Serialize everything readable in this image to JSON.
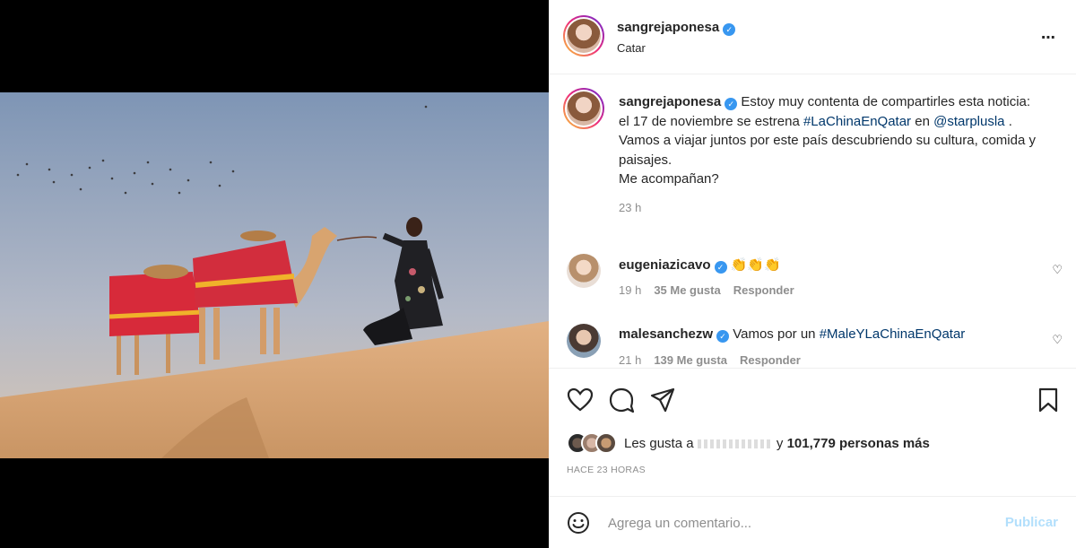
{
  "post": {
    "author": "sangrejaponesa",
    "location": "Catar",
    "more_icon": "⋯"
  },
  "caption": {
    "author": "sangrejaponesa",
    "text_1": "Estoy muy contenta de compartirles esta noticia: el 17 de noviembre se estrena",
    "hashtag": "#LaChinaEnQatar",
    "text_2": "en",
    "mention": "@starplusla",
    "text_3": ".",
    "line_2": "Vamos a viajar juntos por este país descubriendo su cultura, comida y paisajes.",
    "line_3": "Me acompañan?",
    "time": "23 h"
  },
  "comments": [
    {
      "author": "eugeniazicavo",
      "text": "👏👏👏",
      "time": "19 h",
      "likes": "35 Me gusta",
      "reply": "Responder"
    },
    {
      "author": "malesanchezw",
      "text_prefix": "Vamos por un",
      "hashtag": "#MaleYLaChinaEnQatar",
      "time": "21 h",
      "likes": "139 Me gusta",
      "reply": "Responder"
    }
  ],
  "likes": {
    "prefix": "Les gusta a",
    "connector": "y",
    "count_text": "101,779 personas más"
  },
  "timestamp": "HACE 23 HORAS",
  "add_comment": {
    "placeholder": "Agrega un comentario...",
    "publish_label": "Publicar"
  },
  "colors": {
    "link": "#00376b",
    "verified": "#3897f0",
    "muted": "#8e8e8e",
    "publish_disabled": "#b2dffc"
  },
  "icons": [
    "user-tag-icon",
    "more-options-icon",
    "verified-icon",
    "heart-icon",
    "comment-icon",
    "share-icon",
    "bookmark-icon",
    "emoji-icon"
  ]
}
